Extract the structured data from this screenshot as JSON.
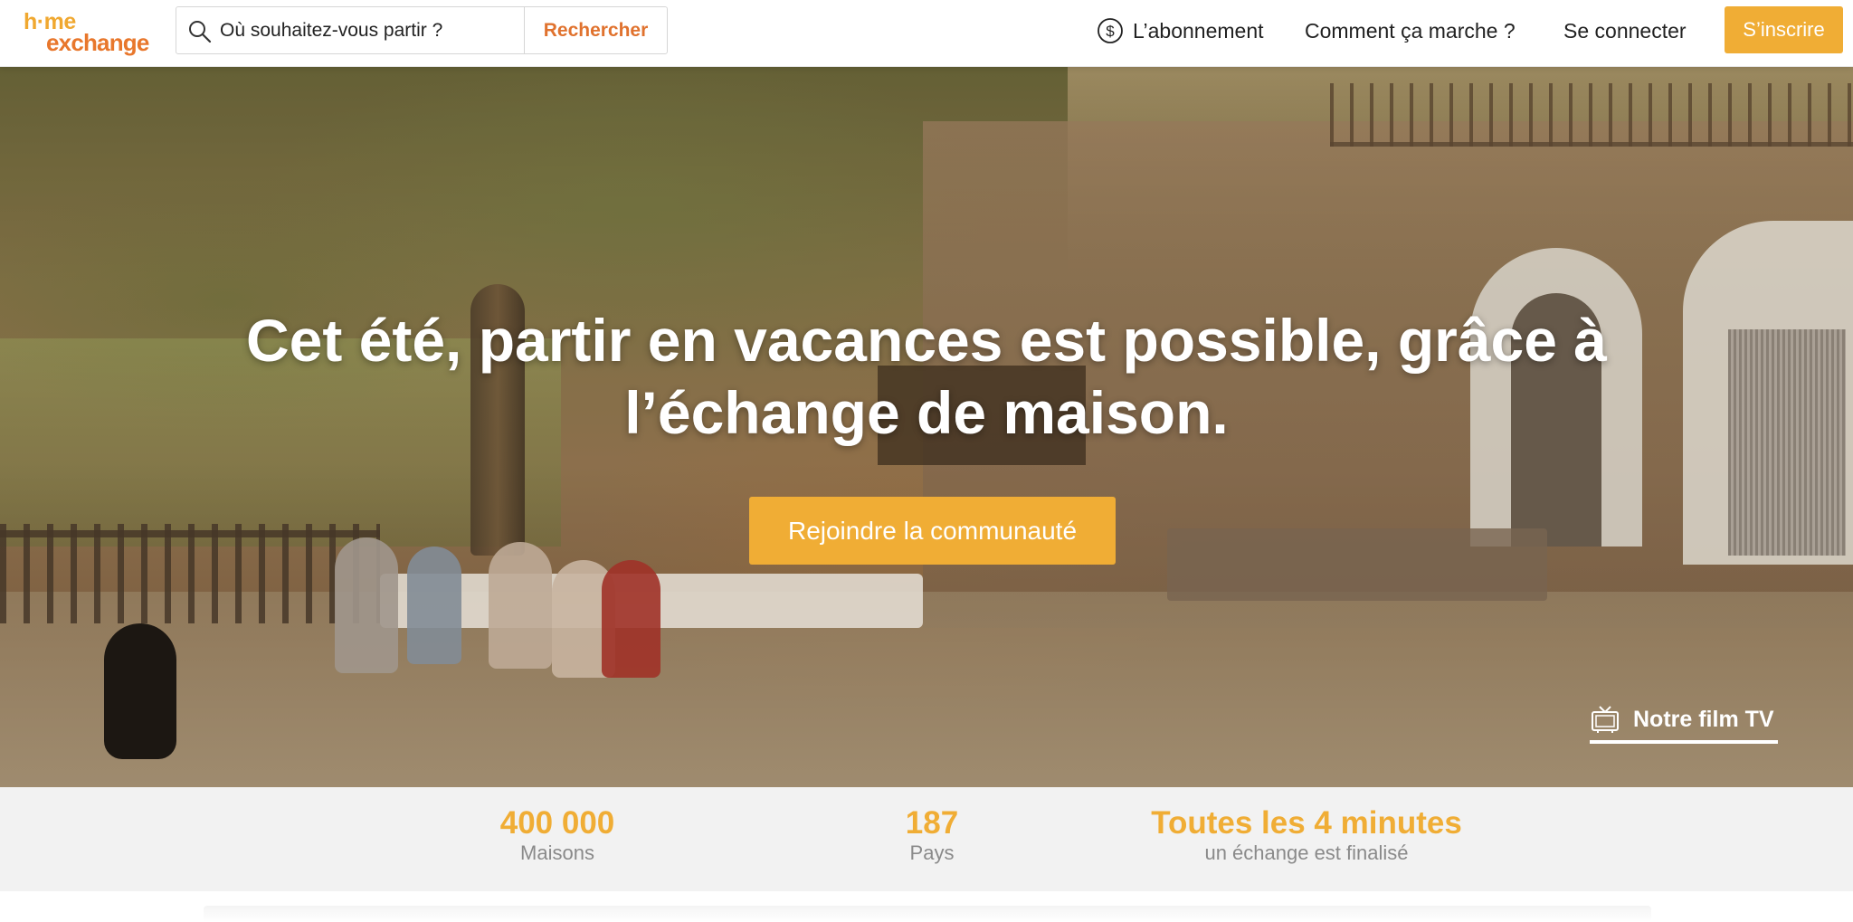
{
  "header": {
    "logo": {
      "line1": "h·me",
      "line2": "exchange"
    },
    "search": {
      "placeholder": "Où souhaitez-vous partir ?",
      "button_label": "Rechercher",
      "icon": "search-icon"
    },
    "nav": {
      "subscription": {
        "label": "L’abonnement",
        "icon": "dollar-circle-icon"
      },
      "how_it_works": {
        "label": "Comment ça marche ?"
      },
      "login": {
        "label": "Se connecter"
      },
      "signup": {
        "label": "S’inscrire"
      }
    }
  },
  "hero": {
    "title": "Cet été, partir en vacances est possible, grâce à l’échange de maison.",
    "cta_label": "Rejoindre la communauté",
    "film": {
      "label": "Notre film TV",
      "icon": "tv-icon"
    }
  },
  "stats": [
    {
      "value": "400 000",
      "label": "Maisons"
    },
    {
      "value": "187",
      "label": "Pays"
    },
    {
      "value": "Toutes les 4 minutes",
      "label": "un échange est finalisé"
    }
  ],
  "colors": {
    "accent": "#f0ad35",
    "accent_dark": "#e0722e",
    "stats_background": "#f2f2f2",
    "muted_text": "#8a8a8a"
  }
}
